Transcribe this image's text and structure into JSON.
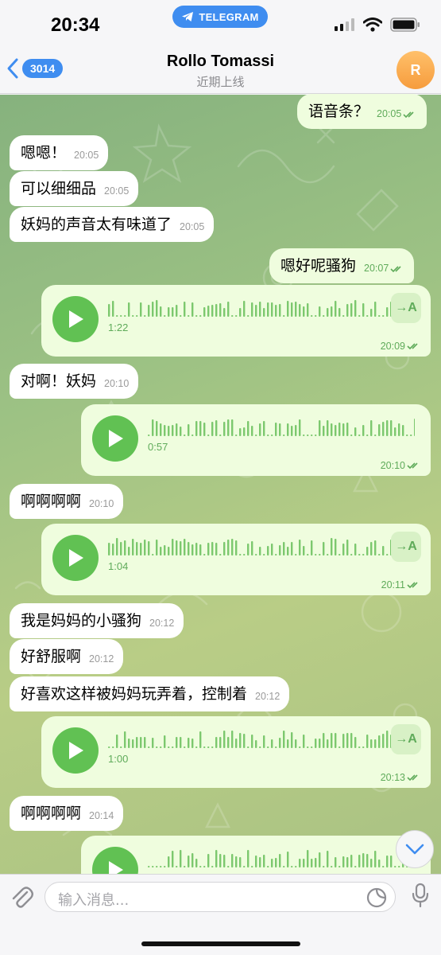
{
  "status_bar": {
    "time": "20:34",
    "app_badge": "TELEGRAM"
  },
  "header": {
    "back_count": "3014",
    "title": "Rollo Tomassi",
    "subtitle": "近期上线",
    "avatar_initial": "R"
  },
  "messages": [
    {
      "type": "text",
      "direction": "out",
      "text": "语音条？",
      "time": "20:05",
      "read": true
    },
    {
      "type": "text",
      "direction": "in",
      "text": "嗯嗯！",
      "time": "20:05"
    },
    {
      "type": "text",
      "direction": "in",
      "text": "可以细细品",
      "time": "20:05"
    },
    {
      "type": "text",
      "direction": "in",
      "text": "妖妈的声音太有味道了",
      "time": "20:05"
    },
    {
      "type": "text",
      "direction": "out",
      "text": "嗯好呢骚狗",
      "time": "20:07",
      "read": true
    },
    {
      "type": "voice",
      "direction": "out",
      "duration": "1:22",
      "time": "20:09",
      "read": true,
      "transcribe_label": "→A"
    },
    {
      "type": "text",
      "direction": "in",
      "text": "对啊！妖妈",
      "time": "20:10"
    },
    {
      "type": "voice",
      "direction": "out",
      "duration": "0:57",
      "time": "20:10",
      "read": true
    },
    {
      "type": "text",
      "direction": "in",
      "text": "啊啊啊啊",
      "time": "20:10"
    },
    {
      "type": "voice",
      "direction": "out",
      "duration": "1:04",
      "time": "20:11",
      "read": true,
      "transcribe_label": "→A"
    },
    {
      "type": "text",
      "direction": "in",
      "text": "我是妈妈的小骚狗",
      "time": "20:12"
    },
    {
      "type": "text",
      "direction": "in",
      "text": "好舒服啊",
      "time": "20:12"
    },
    {
      "type": "text",
      "direction": "in",
      "text": "好喜欢这样被妈妈玩弄着，控制着",
      "time": "20:12"
    },
    {
      "type": "voice",
      "direction": "out",
      "duration": "1:00",
      "time": "20:13",
      "read": true,
      "transcribe_label": "→A"
    },
    {
      "type": "text",
      "direction": "in",
      "text": "啊啊啊啊",
      "time": "20:14"
    },
    {
      "type": "voice",
      "direction": "out",
      "partial": true
    }
  ],
  "input": {
    "placeholder": "输入消息..."
  },
  "icons": {
    "back": "chevron-left-icon",
    "play": "play-icon",
    "read": "double-check-icon",
    "scroll": "chevron-down-icon",
    "attach": "paperclip-icon",
    "sticker": "sticker-icon",
    "mic": "microphone-icon"
  },
  "colors": {
    "accent": "#3f8df0",
    "outgoing_bubble": "#effdde",
    "incoming_bubble": "#ffffff",
    "play_button": "#61c153",
    "avatar": "#f69c3d"
  }
}
